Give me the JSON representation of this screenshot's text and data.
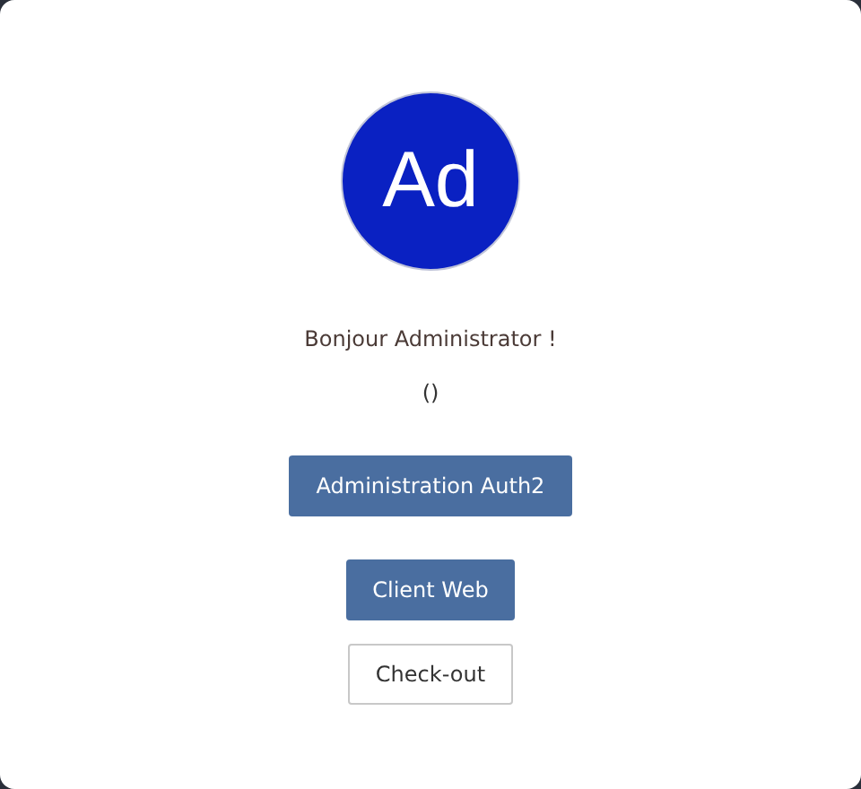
{
  "avatar": {
    "initials": "Ad"
  },
  "greeting": "Bonjour Administrator !",
  "subtitle": "()",
  "buttons": [
    {
      "label": "Administration Auth2",
      "kind": "primary"
    },
    {
      "label": "Client Web",
      "kind": "primary"
    },
    {
      "label": "Check-out",
      "kind": "outline"
    }
  ]
}
